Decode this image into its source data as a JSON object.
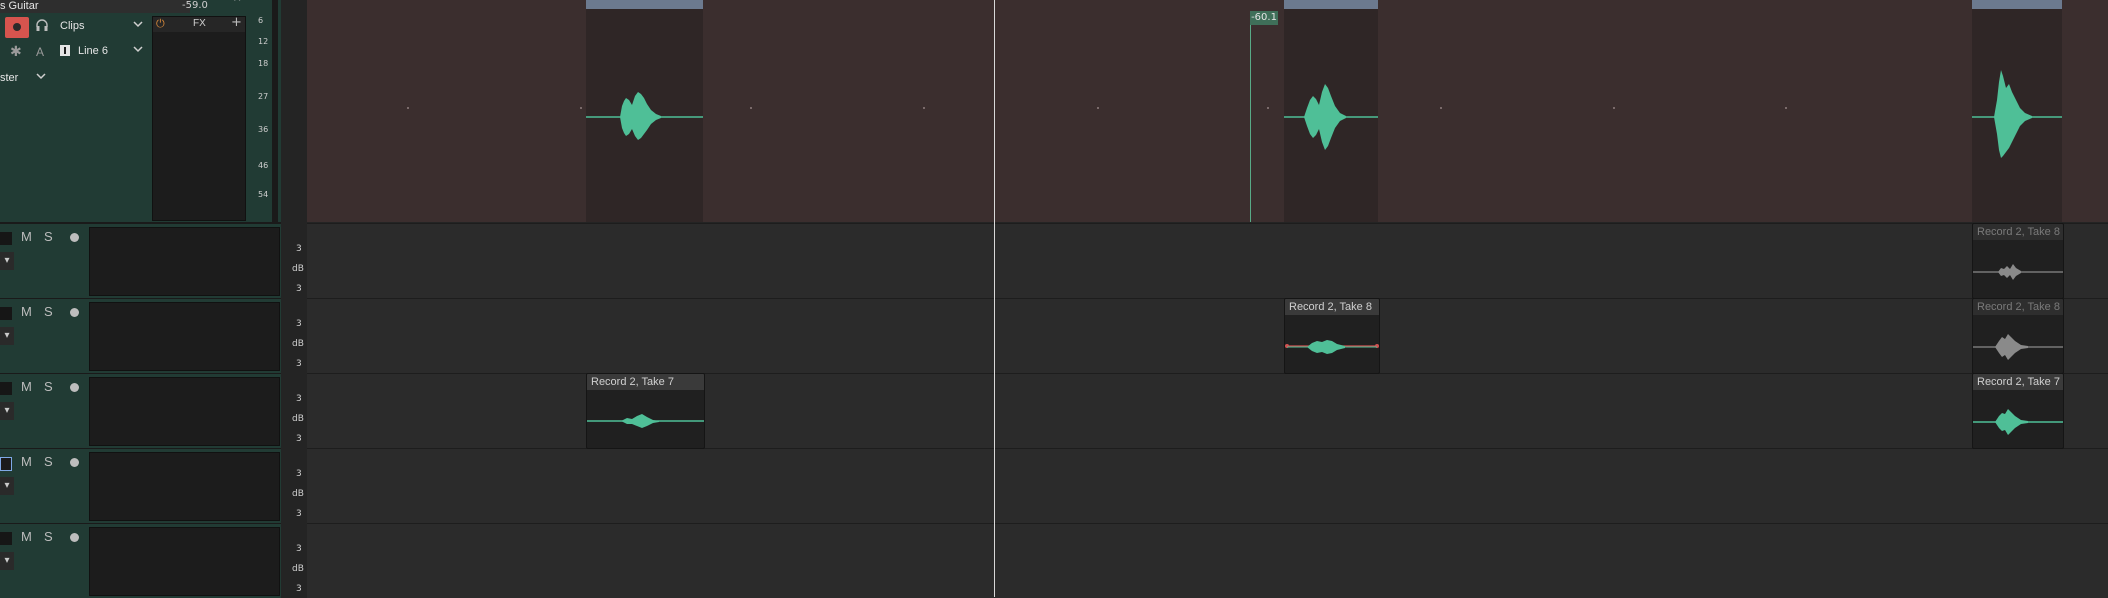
{
  "track_main": {
    "name": "s Guitar",
    "meter_peak": "-59.0",
    "caret_up": "^",
    "input_mode": "Clips",
    "input_label": "Line 6",
    "output_label": "ster",
    "fx_label": "FX",
    "fx_plus": "+",
    "headphones_icon": "headphones-icon",
    "meter_ticks": [
      "6",
      "12",
      "18",
      "27",
      "36",
      "46",
      "54"
    ]
  },
  "tracks": [
    {
      "m": "M",
      "s": "S",
      "db_top": "3",
      "db_unit": "dB",
      "db_bottom": "3",
      "selected": false
    },
    {
      "m": "M",
      "s": "S",
      "db_top": "3",
      "db_unit": "dB",
      "db_bottom": "3",
      "selected": false
    },
    {
      "m": "M",
      "s": "S",
      "db_top": "3",
      "db_unit": "dB",
      "db_bottom": "3",
      "selected": false
    },
    {
      "m": "M",
      "s": "S",
      "db_top": "3",
      "db_unit": "dB",
      "db_bottom": "3",
      "selected": true
    },
    {
      "m": "M",
      "s": "S",
      "db_top": "3",
      "db_unit": "dB",
      "db_bottom": "3",
      "selected": false
    }
  ],
  "timeline": {
    "cursor_value": "-60.1"
  },
  "clips": {
    "take8": "Record 2, Take 8",
    "take7": "Record 2, Take 7",
    "right_lane1": "Record 2, Take 8",
    "right_lane2": "Record 2, Take 8",
    "right_lane3": "Record 2, Take 7"
  },
  "colors": {
    "track_header": "#213b34",
    "record_red": "#d6544e",
    "waveform": "#4fbf97",
    "playhead": "#d8d8d8"
  }
}
